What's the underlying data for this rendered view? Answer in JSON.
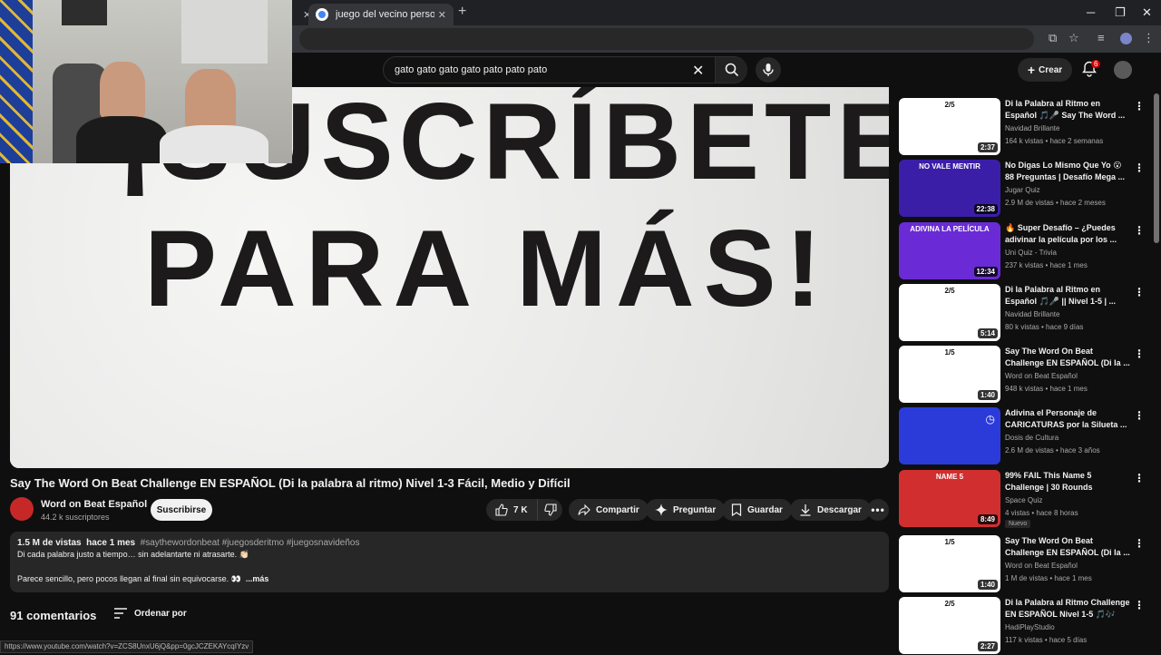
{
  "browser": {
    "tab_title": "juego del vecino personaje pro...",
    "status_url": "https://www.youtube.com/watch?v=ZCS8UnxU6jQ&pp=0gcJCZEKAYcqIYzv"
  },
  "masthead": {
    "search_query": "gato gato gato gato pato pato pato",
    "create_label": "Crear",
    "notification_count": "6"
  },
  "player": {
    "line1": "¡SUSCRÍBETE",
    "line2": "PARA MÁS!"
  },
  "video": {
    "title": "Say The Word On Beat Challenge EN ESPAÑOL (Di la palabra al ritmo) Nivel 1-3 Fácil, Medio y Difícil",
    "channel": "Word on Beat Español",
    "subscribers": "44.2 k suscriptores",
    "subscribe_label": "Suscribirse",
    "likes": "7 K",
    "share_label": "Compartir",
    "ask_label": "Preguntar",
    "save_label": "Guardar",
    "download_label": "Descargar"
  },
  "description": {
    "views": "1.5 M de vistas",
    "date": "hace 1 mes",
    "tags": "#saythewordonbeat #juegosderitmo #juegosnavideños",
    "line1": "Di cada palabra justo a tiempo… sin adelantarte ni atrasarte. 👏🏻",
    "line2": "Parece sencillo, pero pocos llegan al final sin equivocarse. 👀",
    "more": "...más"
  },
  "comments": {
    "count": "91 comentarios",
    "sort_label": "Ordenar por"
  },
  "recommendations": [
    {
      "title": "Di la Palabra al Ritmo en Español 🎵🎤 Say The Word ...",
      "channel": "Navidad Brillante",
      "meta": "164 k vistas • hace 2 semanas",
      "duration": "2:37",
      "thumb_color": "#ffffff",
      "thumb_label": "2/5"
    },
    {
      "title": "No Digas Lo Mismo Que Yo 😮 88 Preguntas | Desafío Mega ...",
      "channel": "Jugar Quiz",
      "meta": "2.9 M de vistas • hace 2 meses",
      "duration": "22:38",
      "thumb_color": "#3b1ea8",
      "thumb_label": "NO VALE MENTIR"
    },
    {
      "title": "🔥 Super Desafío – ¿Puedes adivinar la película por los ...",
      "channel": "Uni Quiz - Trivia",
      "meta": "237 k vistas • hace 1 mes",
      "duration": "12:34",
      "thumb_color": "#6a2bd6",
      "thumb_label": "ADIVINA LA PELÍCULA"
    },
    {
      "title": "Di la Palabra al Ritmo en Español 🎵🎤 || Nivel 1-5 | ...",
      "channel": "Navidad Brillante",
      "meta": "80 k vistas • hace 9 días",
      "duration": "5:14",
      "thumb_color": "#ffffff",
      "thumb_label": "2/5"
    },
    {
      "title": "Say The Word On Beat Challenge EN ESPAÑOL (Di la ...",
      "channel": "Word on Beat Español",
      "meta": "948 k vistas • hace 1 mes",
      "duration": "1:40",
      "thumb_color": "#ffffff",
      "thumb_label": "1/5"
    },
    {
      "title": "Adivina el Personaje de CARICATURAS por la Silueta ...",
      "channel": "Dosis de Cultura",
      "meta": "2.6 M de vistas • hace 3 años",
      "duration": "",
      "thumb_color": "#2b3bd9",
      "thumb_label": ""
    },
    {
      "title": "99% FAIL This Name 5 Challenge | 30 Rounds",
      "channel": "Space Quiz",
      "meta": "4 vistas • hace 8 horas",
      "duration": "8:49",
      "thumb_color": "#d12f2f",
      "thumb_label": "NAME 5",
      "badge": "Nuevo"
    },
    {
      "title": "Say The Word On Beat Challenge EN ESPAÑOL (Di la ...",
      "channel": "Word on Beat Español",
      "meta": "1 M de vistas • hace 1 mes",
      "duration": "1:40",
      "thumb_color": "#ffffff",
      "thumb_label": "1/5"
    },
    {
      "title": "Di la Palabra al Ritmo Challenge EN ESPAÑOL Nivel 1-5 🎵🎶",
      "channel": "HadiPlayStudio",
      "meta": "117 k vistas • hace 5 días",
      "duration": "2:27",
      "thumb_color": "#ffffff",
      "thumb_label": "2/5"
    }
  ]
}
